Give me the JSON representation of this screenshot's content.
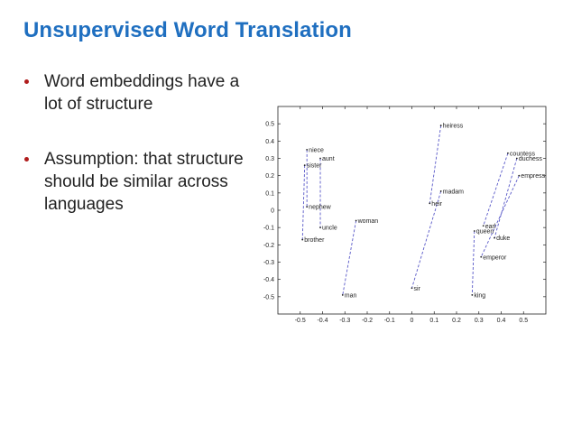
{
  "title": "Unsupervised Word Translation",
  "bullets": [
    "Word embeddings have a lot of structure",
    "Assumption: that structure should be similar across languages"
  ],
  "colors": {
    "title": "#1f6fc0",
    "bullet": "#b01c1c",
    "line": "#5858c8"
  },
  "chart_data": {
    "type": "scatter",
    "xlim": [
      -0.6,
      0.6
    ],
    "ylim": [
      -0.6,
      0.6
    ],
    "x_ticks": [
      -0.5,
      -0.4,
      -0.3,
      -0.2,
      -0.1,
      0,
      0.1,
      0.2,
      0.3,
      0.4,
      0.5
    ],
    "y_ticks": [
      -0.5,
      -0.4,
      -0.3,
      -0.2,
      -0.1,
      0,
      0.1,
      0.2,
      0.3,
      0.4,
      0.5
    ],
    "x_tick_labels": [
      "-0.5",
      "-0.4",
      "-0.3",
      "-0.2",
      "-0.1",
      "0",
      "0.1",
      "0.2",
      "0.3",
      "0.4",
      "0.5"
    ],
    "y_tick_labels": [
      "-0.5",
      "-0.4",
      "-0.3",
      "-0.2",
      "-0.1",
      "0",
      "0.1",
      "0.2",
      "0.3",
      "0.4",
      "0.5"
    ],
    "grid": false,
    "points": [
      {
        "label": "niece",
        "x": -0.47,
        "y": 0.35
      },
      {
        "label": "aunt",
        "x": -0.41,
        "y": 0.3
      },
      {
        "label": "sister",
        "x": -0.48,
        "y": 0.26
      },
      {
        "label": "nephew",
        "x": -0.47,
        "y": 0.02
      },
      {
        "label": "uncle",
        "x": -0.41,
        "y": -0.1
      },
      {
        "label": "brother",
        "x": -0.49,
        "y": -0.17
      },
      {
        "label": "woman",
        "x": -0.25,
        "y": -0.06
      },
      {
        "label": "man",
        "x": -0.31,
        "y": -0.49
      },
      {
        "label": "heiress",
        "x": 0.13,
        "y": 0.49
      },
      {
        "label": "madam",
        "x": 0.13,
        "y": 0.11
      },
      {
        "label": "heir",
        "x": 0.08,
        "y": 0.04
      },
      {
        "label": "sir",
        "x": 0,
        "y": -0.45
      },
      {
        "label": "countess",
        "x": 0.43,
        "y": 0.33
      },
      {
        "label": "duchess",
        "x": 0.47,
        "y": 0.3
      },
      {
        "label": "empress",
        "x": 0.48,
        "y": 0.2
      },
      {
        "label": "earl",
        "x": 0.32,
        "y": -0.09
      },
      {
        "label": "queen",
        "x": 0.28,
        "y": -0.12
      },
      {
        "label": "duke",
        "x": 0.37,
        "y": -0.16
      },
      {
        "label": "emperor",
        "x": 0.31,
        "y": -0.27
      },
      {
        "label": "king",
        "x": 0.27,
        "y": -0.49
      }
    ],
    "pairs": [
      [
        "niece",
        "nephew"
      ],
      [
        "aunt",
        "uncle"
      ],
      [
        "sister",
        "brother"
      ],
      [
        "woman",
        "man"
      ],
      [
        "heiress",
        "heir"
      ],
      [
        "madam",
        "sir"
      ],
      [
        "countess",
        "earl"
      ],
      [
        "duchess",
        "duke"
      ],
      [
        "empress",
        "emperor"
      ],
      [
        "queen",
        "king"
      ]
    ]
  }
}
